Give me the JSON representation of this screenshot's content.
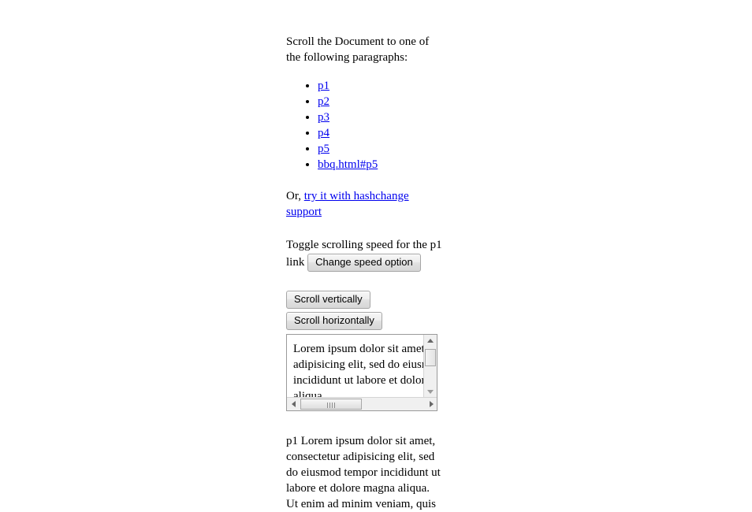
{
  "intro": {
    "text": "Scroll the Document to one of the following paragraphs:"
  },
  "anchor_list": [
    {
      "label": "p1"
    },
    {
      "label": "p2"
    },
    {
      "label": "p3"
    },
    {
      "label": "p4"
    },
    {
      "label": "p5"
    },
    {
      "label": "bbq.html#p5"
    }
  ],
  "hashchange": {
    "prefix": "Or,",
    "link_label": "try it with hashchange support"
  },
  "speed": {
    "text_before": "Toggle scrolling speed for the p1 link",
    "button_label": "Change speed option"
  },
  "scroll_buttons": {
    "vertical_label": "Scroll vertically",
    "horizontal_label": "Scroll horizontally"
  },
  "scroll_box": {
    "content": "Lorem ipsum dolor sit amet, consectetur adipisicing elit, sed do eiusmod tempor incididunt ut labore et dolore magna aliqua."
  },
  "body_copy": {
    "text": "p1 Lorem ipsum dolor sit amet, consectetur adipisicing elit, sed do eiusmod tempor incididunt ut labore et dolore magna aliqua. Ut enim ad minim veniam, quis"
  },
  "colors": {
    "link": "#0000ee",
    "text": "#000000",
    "background": "#ffffff",
    "control_border": "#a6a6a6"
  }
}
